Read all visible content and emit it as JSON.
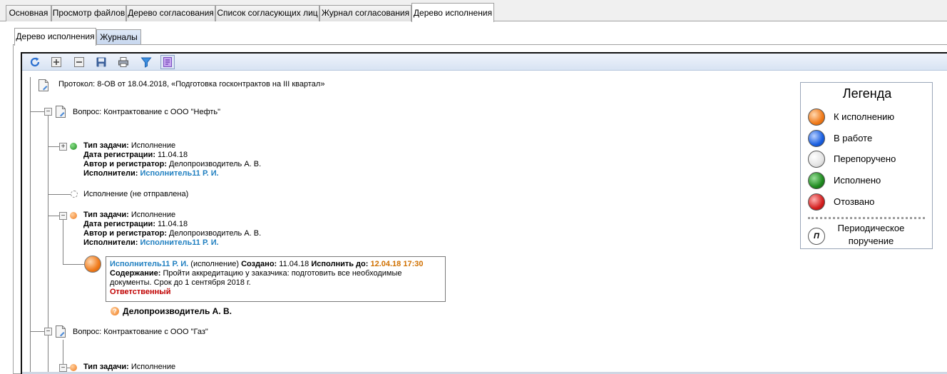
{
  "top_tabs": [
    "Основная",
    "Просмотр файлов",
    "Дерево согласования",
    "Список согласующих лиц",
    "Журнал согласования",
    "Дерево исполнения"
  ],
  "sub_tabs": [
    "Дерево исполнения",
    "Журналы"
  ],
  "toolbar": {
    "icons": [
      "refresh-icon",
      "expand-all-icon",
      "collapse-all-icon",
      "save-icon",
      "print-icon",
      "filter-icon",
      "legend-toggle-icon"
    ]
  },
  "tree": {
    "root_label": "Протокол: 8-ОВ от 18.04.2018, «Подготовка госконтрактов на III квартал»",
    "question1": "Вопрос: Контрактование с ООО \"Нефть\"",
    "question2": "Вопрос: Контрактование с ООО \"Газ\"",
    "task1": {
      "type_label": "Тип задачи:",
      "type_value": " Исполнение",
      "date_label": "Дата регистрации:",
      "date_value": " 11.04.18",
      "author_label": "Автор и регистратор:",
      "author_value": " Делопроизводитель А. В.",
      "exec_label": "Исполнители:",
      "exec_value": "Исполнитель11 Р. И."
    },
    "unsent": "Исполнение (не отправлена)",
    "task2": {
      "type_label": "Тип задачи:",
      "type_value": " Исполнение",
      "date_label": "Дата регистрации:",
      "date_value": " 11.04.18",
      "author_label": "Автор и регистратор:",
      "author_value": " Делопроизводитель А. В.",
      "exec_label": "Исполнители:",
      "exec_value": "Исполнитель11 Р. И."
    },
    "card": {
      "executor": "Исполнитель11 Р. И.",
      "role": " (исполнение) ",
      "created_label": "Создано:",
      "created_value": " 11.04.18 ",
      "due_label": "Исполнить до:",
      "due_value": " 12.04.18 17:30",
      "content_label": "Содержание:",
      "content_line1": " Пройти аккредитацию у заказчика: подготовить все необходимые",
      "content_line2": "документы. Срок до 1 сентября 2018 г.",
      "responsible": "Ответственный"
    },
    "clerk": "Делопроизводитель А. В.",
    "task3": {
      "type_label": "Тип задачи:",
      "type_value": " Исполнение"
    }
  },
  "legend": {
    "title": "Легенда",
    "items": [
      {
        "label": "К исполнению",
        "color": "#f07a1a"
      },
      {
        "label": "В работе",
        "color": "#1a5fe0"
      },
      {
        "label": "Перепоручено",
        "color": "#e4e4e4"
      },
      {
        "label": "Исполнено",
        "color": "#1f8a1f"
      },
      {
        "label": "Отозвано",
        "color": "#d42020"
      }
    ],
    "periodic_line1": "Периодическое",
    "periodic_line2": "поручение"
  },
  "colors": {
    "link": "#1f7fc0",
    "due": "#d07000",
    "responsible": "#c00000"
  }
}
